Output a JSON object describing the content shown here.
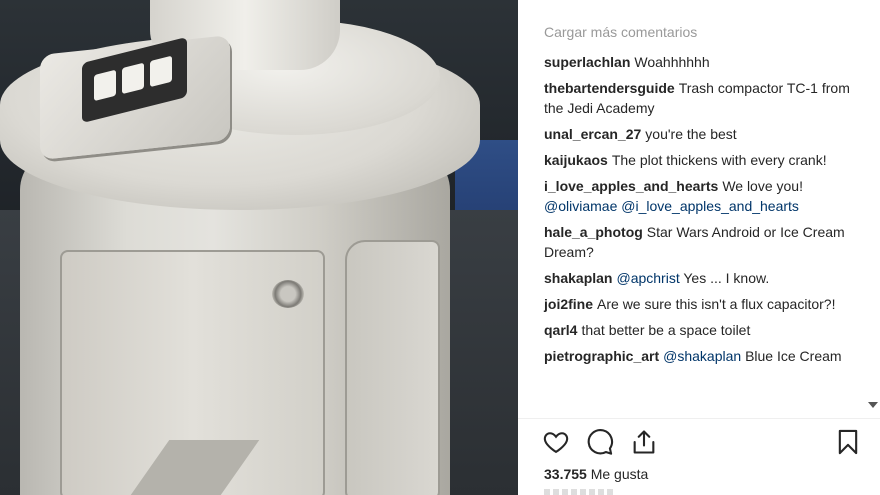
{
  "post": {
    "load_more_label": "Cargar más comentarios",
    "comments": [
      {
        "user": "superlachlan",
        "parts": [
          {
            "text": "Woahhhhhh"
          }
        ]
      },
      {
        "user": "thebartendersguide",
        "parts": [
          {
            "text": "Trash compactor TC-1 from the Jedi Academy"
          }
        ]
      },
      {
        "user": "unal_ercan_27",
        "parts": [
          {
            "text": "you're the best"
          }
        ]
      },
      {
        "user": "kaijukaos",
        "parts": [
          {
            "text": "The plot thickens with every crank!"
          }
        ]
      },
      {
        "user": "i_love_apples_and_hearts",
        "parts": [
          {
            "text": "We love you! "
          },
          {
            "mention": "@oliviamae"
          },
          {
            "text": " "
          },
          {
            "mention": "@i_love_apples_and_hearts"
          }
        ]
      },
      {
        "user": "hale_a_photog",
        "parts": [
          {
            "text": "Star Wars Android or Ice Cream Dream?"
          }
        ]
      },
      {
        "user": "shakaplan",
        "parts": [
          {
            "mention": "@apchrist"
          },
          {
            "text": " Yes ... I know."
          }
        ]
      },
      {
        "user": "joi2fine",
        "parts": [
          {
            "text": "Are we sure this isn't a flux capacitor?!"
          }
        ]
      },
      {
        "user": "qarl4",
        "parts": [
          {
            "text": "that better be a space toilet"
          }
        ]
      },
      {
        "user": "pietrographic_art",
        "parts": [
          {
            "mention": "@shakaplan"
          },
          {
            "text": " Blue Ice Cream"
          }
        ]
      }
    ],
    "likes_count": "33.755",
    "likes_label": "Me gusta"
  },
  "icons": {
    "like": "heart-icon",
    "comment": "comment-bubble-icon",
    "share": "share-upload-icon",
    "save": "bookmark-icon"
  },
  "colors": {
    "text": "#262626",
    "muted": "#999999",
    "mention": "#003569"
  }
}
